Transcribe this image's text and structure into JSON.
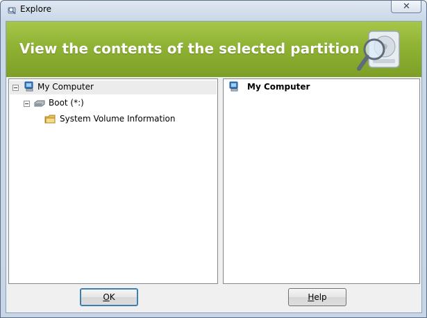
{
  "window": {
    "title": "Explore",
    "close_symbol": "✕"
  },
  "banner": {
    "heading": "View the contents of the selected partition",
    "icon": "disk-magnifier-icon"
  },
  "tree": {
    "items": [
      {
        "label": "My Computer",
        "icon": "computer-icon",
        "expanded": true,
        "selected": true
      },
      {
        "label": "Boot (*:)",
        "icon": "drive-icon",
        "expanded": true
      },
      {
        "label": "System Volume Information",
        "icon": "folder-icon"
      }
    ]
  },
  "list": {
    "items": [
      {
        "label": "My Computer",
        "icon": "computer-icon"
      }
    ]
  },
  "buttons": {
    "ok": {
      "mnemonic": "O",
      "rest": "K"
    },
    "help": {
      "mnemonic": "H",
      "rest": "elp"
    }
  },
  "colors": {
    "banner_green": "#8fb234",
    "selection_gray": "#ececec",
    "window_frame": "#c7d5e6"
  }
}
